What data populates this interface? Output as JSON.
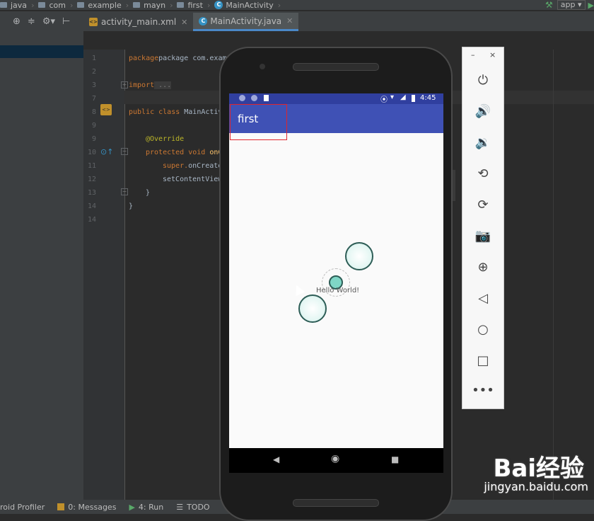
{
  "breadcrumbs": [
    "java",
    "com",
    "example",
    "mayn",
    "first",
    "MainActivity"
  ],
  "run_config": {
    "app_label": "app"
  },
  "tabs": [
    {
      "label": "activity_main.xml",
      "active": false
    },
    {
      "label": "MainActivity.java",
      "active": true
    }
  ],
  "editor": {
    "line_numbers": [
      "1",
      "2",
      "3",
      "7",
      "8",
      "8",
      "9",
      "10",
      "11",
      "12",
      "13",
      "14"
    ],
    "lines": {
      "l1": "package com.example.ma",
      "l3_kw": "import",
      "l3_rest": " ...",
      "l8_kw": "public class",
      "l8_rest": " MainActiv",
      "l9": "@Override",
      "l10_kw": "protected void",
      "l10_rest": " onC",
      "l11_a": "super.",
      "l11_b": "onCreate",
      "l12": "setContentView",
      "l13": "}",
      "l14": "}"
    }
  },
  "device": {
    "status_time": "4:45",
    "app_title": "first",
    "hello_text": "Hello World!"
  },
  "emulator_controls": {
    "minimize": "–",
    "close": "×",
    "buttons": [
      "power-icon",
      "volume-up-icon",
      "volume-down-icon",
      "rotate-left-icon",
      "rotate-right-icon",
      "camera-icon",
      "zoom-icon",
      "back-icon",
      "home-icon",
      "overview-icon",
      "more-icon"
    ]
  },
  "status_bar": {
    "items": [
      {
        "label": "roid Profiler"
      },
      {
        "label": "0: Messages"
      },
      {
        "label": "4: Run"
      },
      {
        "label": "TODO"
      }
    ]
  },
  "watermark": {
    "brand": "Bai经验",
    "url": "jingyan.baidu.com"
  },
  "colors": {
    "app_bar": "#3f51b5",
    "status_bar": "#303f9f",
    "highlight_box": "#e0252c",
    "ide_bg": "#2b2b2b"
  }
}
